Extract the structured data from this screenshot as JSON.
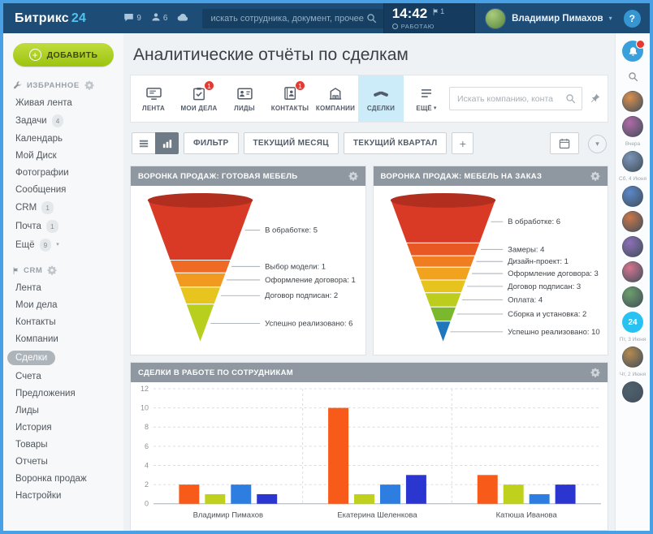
{
  "topbar": {
    "logo_brand": "Битрикс",
    "logo_suffix": "24",
    "chat_count": "9",
    "people_count": "6",
    "search_placeholder": "искать сотрудника, документ, прочее.",
    "time": "14:42",
    "flag_count": "1",
    "status": "РАБОТАЮ",
    "user_name": "Владимир Пимахов",
    "help_label": "?"
  },
  "sidebar": {
    "add_label": "ДОБАВИТЬ",
    "sections": [
      {
        "title": "ИЗБРАННОЕ",
        "icon": "wrench-icon",
        "items": [
          {
            "name": "live-feed",
            "label": "Живая лента"
          },
          {
            "name": "tasks",
            "label": "Задачи",
            "badge": "4"
          },
          {
            "name": "calendar",
            "label": "Календарь"
          },
          {
            "name": "my-disk",
            "label": "Мой Диск"
          },
          {
            "name": "photos",
            "label": "Фотографии"
          },
          {
            "name": "messages",
            "label": "Сообщения"
          },
          {
            "name": "crm",
            "label": "CRM",
            "badge": "1"
          },
          {
            "name": "mail",
            "label": "Почта",
            "badge": "1"
          },
          {
            "name": "more",
            "label": "Ещё",
            "badge": "9",
            "chevron": true
          }
        ]
      },
      {
        "title": "CRM",
        "icon": "flag-icon",
        "items": [
          {
            "name": "feed",
            "label": "Лента"
          },
          {
            "name": "my-affairs",
            "label": "Мои дела"
          },
          {
            "name": "contacts",
            "label": "Контакты"
          },
          {
            "name": "companies",
            "label": "Компании"
          },
          {
            "name": "deals",
            "label": "Сделки",
            "selected": true
          },
          {
            "name": "invoices",
            "label": "Счета"
          },
          {
            "name": "quotes",
            "label": "Предложения"
          },
          {
            "name": "leads",
            "label": "Лиды"
          },
          {
            "name": "history",
            "label": "История"
          },
          {
            "name": "products",
            "label": "Товары"
          },
          {
            "name": "reports",
            "label": "Отчеты"
          },
          {
            "name": "sales-funnel",
            "label": "Воронка продаж"
          },
          {
            "name": "settings",
            "label": "Настройки"
          }
        ]
      }
    ]
  },
  "main": {
    "page_title": "Аналитические отчёты по сделкам",
    "tabs": [
      {
        "name": "feed",
        "icon": "feed",
        "label": "ЛЕНТА"
      },
      {
        "name": "my-affairs",
        "icon": "tasks",
        "label": "МОИ ДЕЛА",
        "badge": "1"
      },
      {
        "name": "leads",
        "icon": "leads",
        "label": "ЛИДЫ"
      },
      {
        "name": "contacts",
        "icon": "contacts",
        "label": "КОНТАКТЫ",
        "badge": "1"
      },
      {
        "name": "companies",
        "icon": "companies",
        "label": "КОМПАНИИ"
      },
      {
        "name": "deals",
        "icon": "deals",
        "label": "СДЕЛКИ",
        "selected": true
      },
      {
        "name": "more",
        "icon": "more",
        "label": "ЕЩЁ",
        "chevron": true
      }
    ],
    "tab_search_placeholder": "Искать компанию, конта",
    "toolbar": {
      "filter": "ФИЛЬТР",
      "current_month": "ТЕКУЩИЙ МЕСЯЦ",
      "current_quarter": "ТЕКУЩИЙ КВАРТАЛ",
      "add": "+"
    }
  },
  "right_rail": {
    "items": [
      {
        "type": "button",
        "name": "notifications",
        "icon": "bell",
        "badge_dot": true
      },
      {
        "type": "button",
        "name": "rail-search",
        "icon": "search"
      },
      {
        "type": "avatar",
        "color": "#d98f4e"
      },
      {
        "type": "avatar",
        "color": "#b06aa5"
      },
      {
        "type": "label",
        "text": "Вчера"
      },
      {
        "type": "avatar",
        "color": "#7c95b8"
      },
      {
        "type": "label",
        "text": "Сб, 4 Июня"
      },
      {
        "type": "avatar",
        "color": "#5b87c9"
      },
      {
        "type": "avatar",
        "color": "#c9764a"
      },
      {
        "type": "avatar",
        "color": "#8d6fb5"
      },
      {
        "type": "avatar",
        "color": "#d4758f"
      },
      {
        "type": "avatar",
        "color": "#6d9e6b"
      },
      {
        "type": "avatar24",
        "text": "24"
      },
      {
        "type": "label",
        "text": "Пт, 3 Июня"
      },
      {
        "type": "avatar",
        "color": "#b58a50"
      },
      {
        "type": "label",
        "text": "Чт, 2 Июня"
      },
      {
        "type": "avatar",
        "color": "#50616e"
      }
    ]
  },
  "chart_data": [
    {
      "type": "funnel",
      "title": "ВОРОНКА ПРОДАЖ: ГОТОВАЯ МЕБЕЛЬ",
      "stages": [
        {
          "label": "В обработке",
          "value": 5,
          "color": "#d93a26",
          "frac": 0.42
        },
        {
          "label": "Выбор модели",
          "value": 1,
          "color": "#ef6a25",
          "frac": 0.09
        },
        {
          "label": "Оформление договора",
          "value": 1,
          "color": "#f29a20",
          "frac": 0.1
        },
        {
          "label": "Договор подписан",
          "value": 2,
          "color": "#e8c41e",
          "frac": 0.12
        },
        {
          "label": "Успешно реализовано",
          "value": 6,
          "color": "#b9cf1e",
          "frac": 0.27
        }
      ]
    },
    {
      "type": "funnel",
      "title": "ВОРОНКА ПРОДАЖ: МЕБЕЛЬ НА ЗАКАЗ",
      "stages": [
        {
          "label": "В обработке",
          "value": 6,
          "color": "#d93a26",
          "frac": 0.3
        },
        {
          "label": "Замеры",
          "value": 4,
          "color": "#e85824",
          "frac": 0.09
        },
        {
          "label": "Дизайн-проект",
          "value": 1,
          "color": "#f07e21",
          "frac": 0.08
        },
        {
          "label": "Оформление договора",
          "value": 3,
          "color": "#f2a31d",
          "frac": 0.09
        },
        {
          "label": "Договор подписан",
          "value": 3,
          "color": "#e6c31d",
          "frac": 0.09
        },
        {
          "label": "Оплата",
          "value": 4,
          "color": "#bccd1d",
          "frac": 0.1
        },
        {
          "label": "Сборка и установка",
          "value": 2,
          "color": "#7cb82d",
          "frac": 0.1
        },
        {
          "label": "Успешно реализовано",
          "value": 10,
          "color": "#1f78bd",
          "frac": 0.15
        }
      ]
    },
    {
      "type": "bar",
      "title": "СДЕЛКИ В РАБОТЕ ПО СОТРУДНИКАМ",
      "categories": [
        "Владимир Пимахов",
        "Екатерина Шеленкова",
        "Катюша Иванова"
      ],
      "series": [
        {
          "color": "#f85a19",
          "values": [
            2,
            10,
            3
          ]
        },
        {
          "color": "#bfd11c",
          "values": [
            1,
            1,
            2
          ]
        },
        {
          "color": "#2e7de0",
          "values": [
            2,
            2,
            1
          ]
        },
        {
          "color": "#2b35cf",
          "values": [
            1,
            3,
            2
          ]
        }
      ],
      "ylim": [
        0,
        12
      ],
      "ytick_step": 2,
      "grid": true,
      "legend": "none"
    }
  ]
}
